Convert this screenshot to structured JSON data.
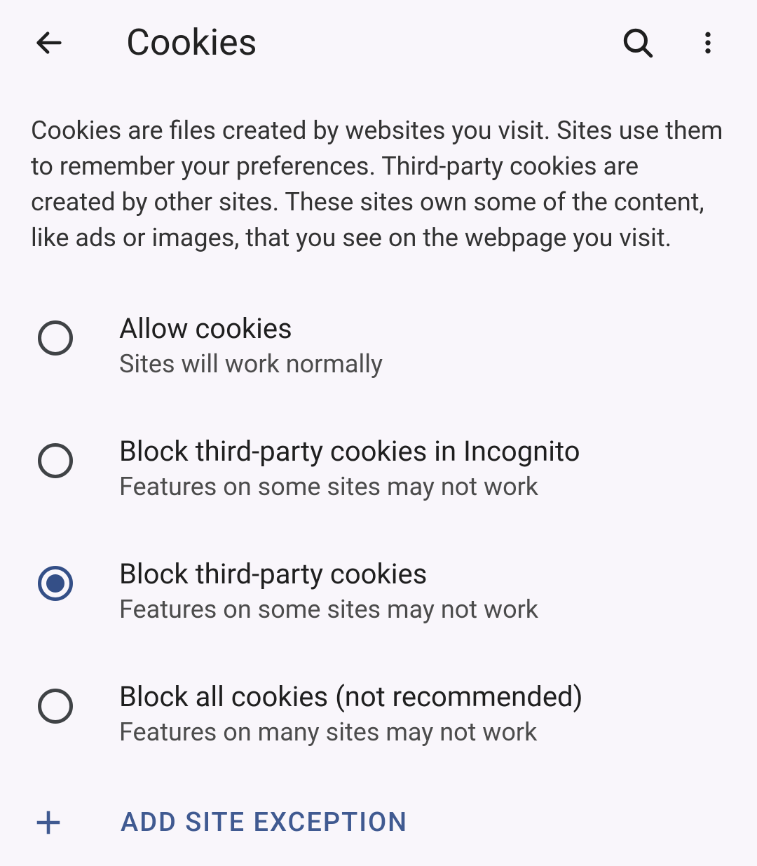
{
  "header": {
    "title": "Cookies"
  },
  "description": "Cookies are files created by websites you visit. Sites use them to remember your preferences. Third-party cookies are created by other sites. These sites own some of the content, like ads or images, that you see on the webpage you visit.",
  "options": [
    {
      "title": "Allow cookies",
      "subtitle": "Sites will work normally",
      "selected": false
    },
    {
      "title": "Block third-party cookies in Incognito",
      "subtitle": "Features on some sites may not work",
      "selected": false
    },
    {
      "title": "Block third-party cookies",
      "subtitle": "Features on some sites may not work",
      "selected": true
    },
    {
      "title": "Block all cookies (not recommended)",
      "subtitle": "Features on many sites may not work",
      "selected": false
    }
  ],
  "add_exception_label": "ADD SITE EXCEPTION",
  "colors": {
    "accent": "#405a91",
    "text_primary": "#1f1f1f",
    "text_secondary": "#4c4c4c",
    "radio_ring": "#404346",
    "background": "#f9f6fb"
  }
}
